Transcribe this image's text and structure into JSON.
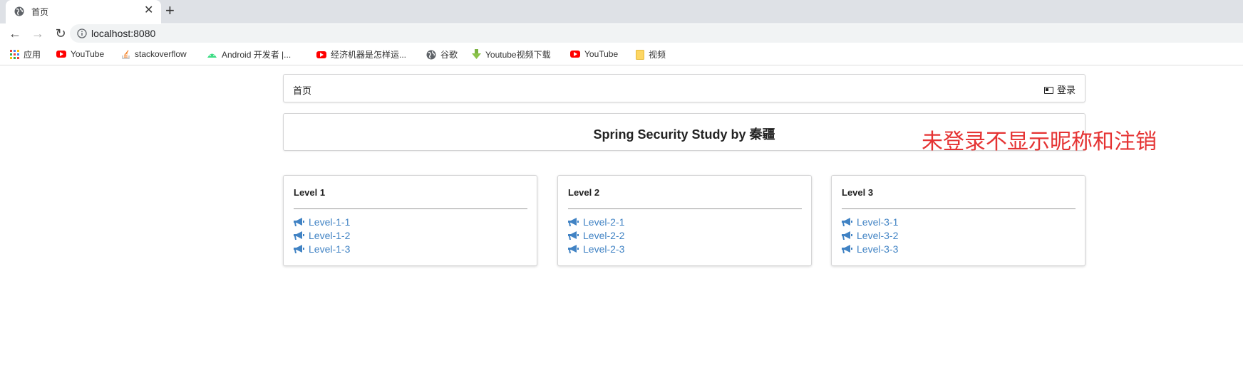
{
  "browser": {
    "tab_title": "首页",
    "tab_close": "✕",
    "new_tab": "+",
    "url": "localhost:8080",
    "nav": {
      "back": "←",
      "forward": "→",
      "reload": "↻"
    }
  },
  "bookmarks": [
    {
      "label": "应用",
      "icon": "apps-grid-icon"
    },
    {
      "label": "YouTube",
      "icon": "youtube-icon"
    },
    {
      "label": "stackoverflow",
      "icon": "stackoverflow-icon"
    },
    {
      "label": "Android 开发者 |...",
      "icon": "android-icon"
    },
    {
      "label": "经济机器是怎样运...",
      "icon": "youtube-icon"
    },
    {
      "label": "谷歌",
      "icon": "globe-icon"
    },
    {
      "label": "Youtube视频下载",
      "icon": "download-icon"
    },
    {
      "label": "YouTube",
      "icon": "youtube-icon"
    },
    {
      "label": "视频",
      "icon": "folder-icon"
    }
  ],
  "navbar": {
    "home": "首页",
    "login": "登录"
  },
  "header": {
    "title": "Spring Security Study by 秦疆"
  },
  "annotation": "未登录不显示昵称和注销",
  "cards": [
    {
      "title": "Level 1",
      "links": [
        "Level-1-1",
        "Level-1-2",
        "Level-1-3"
      ]
    },
    {
      "title": "Level 2",
      "links": [
        "Level-2-1",
        "Level-2-2",
        "Level-2-3"
      ]
    },
    {
      "title": "Level 3",
      "links": [
        "Level-3-1",
        "Level-3-2",
        "Level-3-3"
      ]
    }
  ],
  "colors": {
    "link": "#4183c4",
    "annotation": "#e53333",
    "youtube": "#ff0000"
  }
}
